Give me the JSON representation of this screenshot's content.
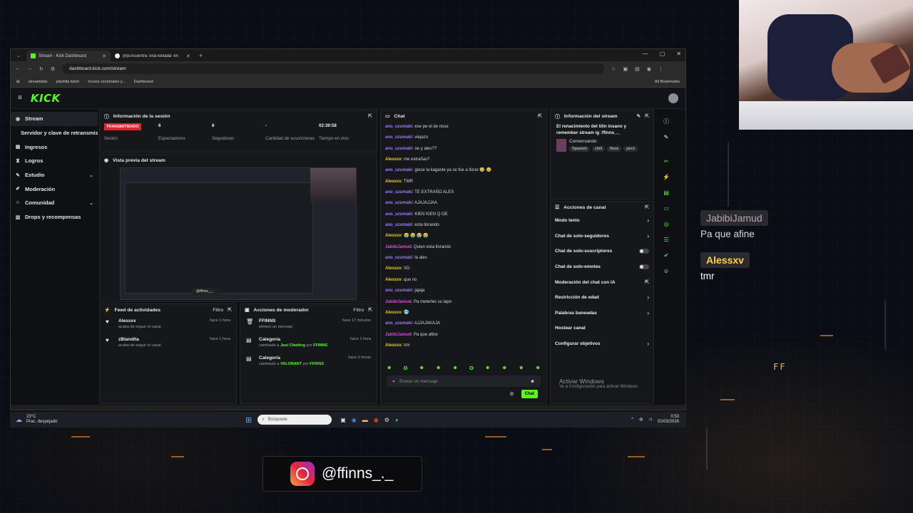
{
  "browser": {
    "tabs": [
      {
        "title": "Stream - Kick Dashboard",
        "active": true
      },
      {
        "title": "(8)Encuentra 'eña keitada' en T",
        "active": false
      }
    ],
    "url": "dashboard.kick.com/stream",
    "bookmarks": [
      "streamlabs",
      "plantilla twich",
      "Iconos vectoriales y...",
      "Dashboard"
    ],
    "all_bookmarks": "All Bookmarks"
  },
  "kick": {
    "logo": "KICK",
    "sidebar": [
      {
        "label": "Stream",
        "icon": "stream-icon",
        "active": true
      },
      {
        "label": "Servidor y clave de retransmisión",
        "sub": true
      },
      {
        "label": "Ingresos",
        "icon": "money-icon"
      },
      {
        "label": "Logros",
        "icon": "trophy-icon"
      },
      {
        "label": "Estudio",
        "icon": "brush-icon",
        "chevron": true
      },
      {
        "label": "Moderación",
        "icon": "shield-icon"
      },
      {
        "label": "Comunidad",
        "icon": "people-icon",
        "chevron": true
      },
      {
        "label": "Drops y recompensas",
        "icon": "gift-icon"
      }
    ],
    "session": {
      "title": "Información de la sesión",
      "status_badge": "TRANSMITIENDO",
      "stats": [
        {
          "value": "",
          "label": "Sesión"
        },
        {
          "value": "6",
          "label": "Espectadores"
        },
        {
          "value": "8",
          "label": "Seguidores"
        },
        {
          "value": "-",
          "label": "Cantidad de suscriciones"
        },
        {
          "value": "02:39:58",
          "label": "Tiempo en vivo"
        }
      ]
    },
    "preview": {
      "title": "Vista previa del stream",
      "handle": "@ffinns_._"
    },
    "activity": {
      "title": "Feed de actividades",
      "filter": "Filtro",
      "items": [
        {
          "name": "Alessxv",
          "sub": "acaba de seguir el canal",
          "time": "hace 1 hora"
        },
        {
          "name": "zBlandita",
          "sub": "acaba de seguir el canal",
          "time": "hace 1 hora"
        }
      ]
    },
    "modactions": {
      "title": "Acciones de moderador",
      "filter": "Filtro",
      "items": [
        {
          "name": "FFINNS",
          "pre": "eliminó un mensaje",
          "hl": "",
          "post": "",
          "by": "",
          "time": "hace 17 minutos"
        },
        {
          "name": "Categoría",
          "pre": "cambiado a ",
          "hl": "Just Chatting",
          "post": " por ",
          "by": "FFINNS",
          "time": "hace 1 hora"
        },
        {
          "name": "Categoría",
          "pre": "cambiado a ",
          "hl": "VALORANT",
          "post": " por ",
          "by": "FFINNS",
          "time": "hace 2 horas"
        }
      ]
    },
    "chat": {
      "title": "Chat",
      "messages": [
        {
          "user": "ano_uzumaki",
          "c": "u1",
          "text": ": ese pe el de nose"
        },
        {
          "user": "ano_uzumaki",
          "c": "u1",
          "text": ": viejazo"
        },
        {
          "user": "ano_uzumaki",
          "c": "u1",
          "text": ": oe y ales??"
        },
        {
          "user": "Alessxv",
          "c": "u2",
          "text": ": me extrañas?"
        },
        {
          "user": "ano_uzumaki",
          "c": "u1",
          "text": ": gioce la kagaste ya se fue a llorar 😢 😢"
        },
        {
          "user": "Alessxv",
          "c": "u2",
          "text": ": TMR"
        },
        {
          "user": "ano_uzumaki",
          "c": "u1",
          "text": ": TE EXTRAÑO ALES"
        },
        {
          "user": "ano_uzumaki",
          "c": "u1",
          "text": ": AJAJAJJAA"
        },
        {
          "user": "ano_uzumaki",
          "c": "u1",
          "text": ": KIEN KIEN Q OE"
        },
        {
          "user": "ano_uzumaki",
          "c": "u1",
          "text": ": esta llorando"
        },
        {
          "user": "Alessxv",
          "c": "u2",
          "text": ": 😭 😭 😭 😭"
        },
        {
          "user": "JabibiJamud",
          "c": "u3",
          "text": ": Quien esta llorando"
        },
        {
          "user": "ano_uzumaki",
          "c": "u1",
          "text": ": la ales"
        },
        {
          "user": "Alessxv",
          "c": "u2",
          "text": ": XD"
        },
        {
          "user": "Alessxv",
          "c": "u2",
          "text": ": que no"
        },
        {
          "user": "ano_uzumaki",
          "c": "u1",
          "text": ": jajaja"
        },
        {
          "user": "JabibiJamud",
          "c": "u3",
          "text": ": Pa meterles su lapo"
        },
        {
          "user": "Alessxv",
          "c": "u2",
          "text": ": 🥶"
        },
        {
          "user": "ano_uzumaki",
          "c": "u1",
          "text": ": AJJAJAKAJA"
        },
        {
          "user": "JabibiJamud",
          "c": "u3",
          "text": ": Pa que afine"
        },
        {
          "user": "Alessxv",
          "c": "u2",
          "text": ": tmr"
        }
      ],
      "emotes": [
        "☻",
        "✪",
        "☻",
        "☻",
        "☻",
        "✪",
        "☻",
        "☻",
        "☻",
        "☻"
      ],
      "placeholder": "Enviar un mensaje",
      "send_label": "Chat"
    },
    "stream_info": {
      "title": "Información del stream",
      "stream_title": "El renacimiento del tilin insano y remember stream ig :ffinns_._",
      "category": "Conversando",
      "tags": [
        "Spanish",
        "chill",
        "finns",
        "perú"
      ]
    },
    "channel_actions": {
      "title": "Acciones de canal",
      "items": [
        {
          "label": "Modo lento",
          "kind": "chevron"
        },
        {
          "label": "Chat de solo-seguidores",
          "kind": "chevron"
        },
        {
          "label": "Chat de solo-suscriptores",
          "kind": "toggle"
        },
        {
          "label": "Chat de solo-emotes",
          "kind": "toggle"
        },
        {
          "label": "Moderación del chat con IA",
          "kind": "icon"
        },
        {
          "label": "Restricción de edad",
          "kind": "chevron"
        },
        {
          "label": "Palabras baneadas",
          "kind": "chevron"
        },
        {
          "label": "Hostear canal",
          "kind": "none"
        },
        {
          "label": "Configurar objetivos",
          "kind": "chevron"
        }
      ]
    },
    "activate_windows": {
      "title": "Activar Windows",
      "sub": "Ve a Configuración para activar Windows."
    }
  },
  "taskbar": {
    "temp": "23°C",
    "weather": "Prac. despejado",
    "search_placeholder": "Búsqueda",
    "time": "0:53",
    "date": "01/03/2026"
  },
  "overlay": {
    "chat": [
      {
        "name": "JabibiJamud",
        "name_color": "#b9a5a8",
        "msg": "Pa que afine"
      },
      {
        "name": "Alessxv",
        "name_color": "#ffd23d",
        "msg": "tmr"
      }
    ],
    "instagram": "@ffinns_._",
    "deco": "FF"
  }
}
